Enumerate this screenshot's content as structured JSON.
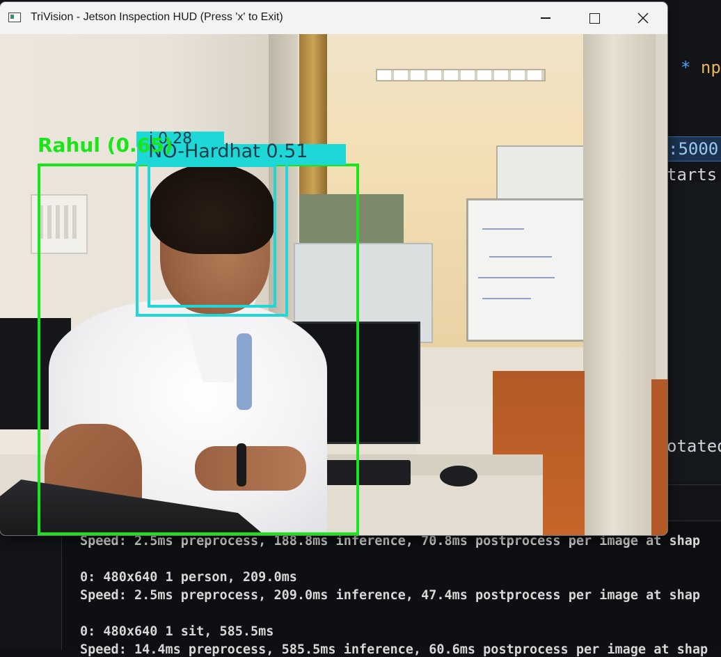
{
  "window": {
    "title": "TriVision - Jetson Inspection HUD (Press 'x' to Exit)",
    "controls": {
      "minimize": "minimize",
      "maximize": "maximize",
      "close": "close"
    }
  },
  "detections": [
    {
      "label": "Rahul (0.65)",
      "color": "#19e619"
    },
    {
      "label": "NO-Hardhat 0.51",
      "color": "#1ed8d8"
    },
    {
      "label": "i 0.28",
      "color": "#1ed8d8"
    }
  ],
  "background_editor": {
    "fragments": {
      "np": "np",
      "star": "*",
      "port": ":5000",
      "starts": "tarts",
      "rotated": "otated"
    }
  },
  "terminal": {
    "lines": [
      "Speed: 2.5ms preprocess, 188.8ms inference, 70.8ms postprocess per image at shap",
      "",
      "0: 480x640 1 person, 209.0ms",
      "Speed: 2.5ms preprocess, 209.0ms inference, 47.4ms postprocess per image at shap",
      "",
      "0: 480x640 1 sit, 585.5ms",
      "Speed: 14.4ms preprocess, 585.5ms inference, 60.6ms postprocess per image at shap"
    ]
  }
}
